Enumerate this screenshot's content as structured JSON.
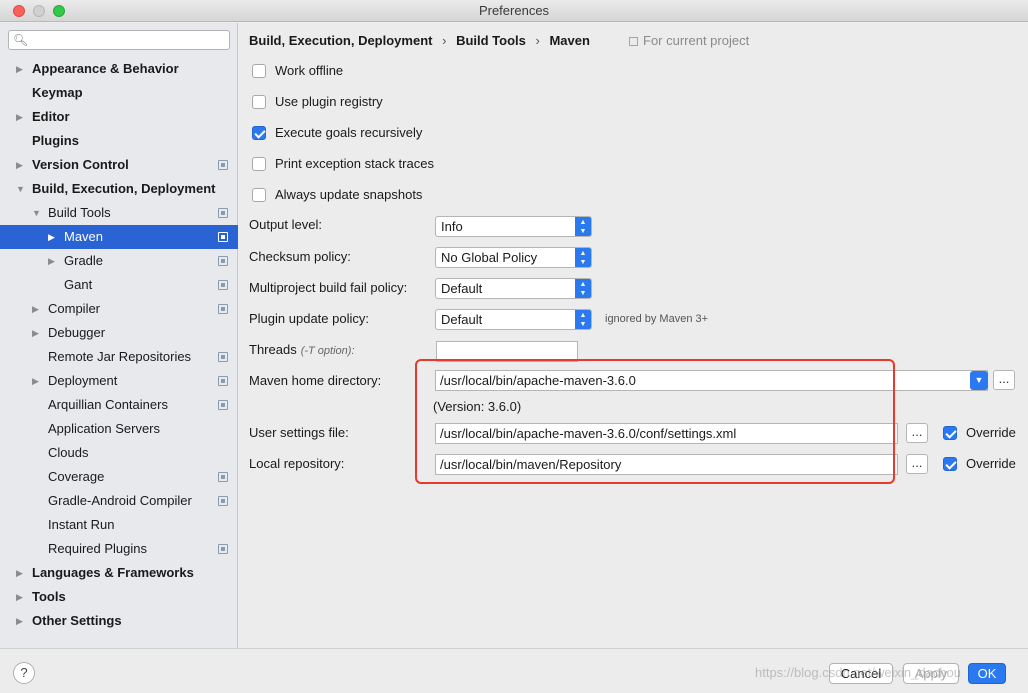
{
  "window": {
    "title": "Preferences"
  },
  "sidebar": {
    "search_value": "",
    "items": [
      {
        "label": "Appearance & Behavior",
        "bold": true,
        "arrow": "right",
        "level": 0,
        "project_icon": false
      },
      {
        "label": "Keymap",
        "bold": true,
        "arrow": "none",
        "level": 0,
        "project_icon": false
      },
      {
        "label": "Editor",
        "bold": true,
        "arrow": "right",
        "level": 0,
        "project_icon": false
      },
      {
        "label": "Plugins",
        "bold": true,
        "arrow": "none",
        "level": 0,
        "project_icon": false
      },
      {
        "label": "Version Control",
        "bold": true,
        "arrow": "right",
        "level": 0,
        "project_icon": true
      },
      {
        "label": "Build, Execution, Deployment",
        "bold": true,
        "arrow": "down",
        "level": 0,
        "project_icon": false
      },
      {
        "label": "Build Tools",
        "bold": false,
        "arrow": "down",
        "level": 1,
        "project_icon": true
      },
      {
        "label": "Maven",
        "bold": false,
        "arrow": "right",
        "level": 2,
        "project_icon": true,
        "selected": true
      },
      {
        "label": "Gradle",
        "bold": false,
        "arrow": "right",
        "level": 2,
        "project_icon": true
      },
      {
        "label": "Gant",
        "bold": false,
        "arrow": "none",
        "level": 2,
        "project_icon": true
      },
      {
        "label": "Compiler",
        "bold": false,
        "arrow": "right",
        "level": 1,
        "project_icon": true
      },
      {
        "label": "Debugger",
        "bold": false,
        "arrow": "right",
        "level": 1,
        "project_icon": false
      },
      {
        "label": "Remote Jar Repositories",
        "bold": false,
        "arrow": "none",
        "level": 1,
        "project_icon": true
      },
      {
        "label": "Deployment",
        "bold": false,
        "arrow": "right",
        "level": 1,
        "project_icon": true
      },
      {
        "label": "Arquillian Containers",
        "bold": false,
        "arrow": "none",
        "level": 1,
        "project_icon": true
      },
      {
        "label": "Application Servers",
        "bold": false,
        "arrow": "none",
        "level": 1,
        "project_icon": false
      },
      {
        "label": "Clouds",
        "bold": false,
        "arrow": "none",
        "level": 1,
        "project_icon": false
      },
      {
        "label": "Coverage",
        "bold": false,
        "arrow": "none",
        "level": 1,
        "project_icon": true
      },
      {
        "label": "Gradle-Android Compiler",
        "bold": false,
        "arrow": "none",
        "level": 1,
        "project_icon": true
      },
      {
        "label": "Instant Run",
        "bold": false,
        "arrow": "none",
        "level": 1,
        "project_icon": false
      },
      {
        "label": "Required Plugins",
        "bold": false,
        "arrow": "none",
        "level": 1,
        "project_icon": true
      },
      {
        "label": "Languages & Frameworks",
        "bold": true,
        "arrow": "right",
        "level": 0,
        "project_icon": false
      },
      {
        "label": "Tools",
        "bold": true,
        "arrow": "right",
        "level": 0,
        "project_icon": false
      },
      {
        "label": "Other Settings",
        "bold": true,
        "arrow": "right",
        "level": 0,
        "project_icon": false
      }
    ]
  },
  "breadcrumb": {
    "parts": [
      "Build, Execution, Deployment",
      "Build Tools",
      "Maven"
    ],
    "separator": "›",
    "for_project": "For current project"
  },
  "checkboxes": [
    {
      "label": "Work offline",
      "checked": false
    },
    {
      "label": "Use plugin registry",
      "checked": false
    },
    {
      "label": "Execute goals recursively",
      "checked": true
    },
    {
      "label": "Print exception stack traces",
      "checked": false
    },
    {
      "label": "Always update snapshots",
      "checked": false
    }
  ],
  "selects": [
    {
      "label": "Output level:",
      "value": "Info"
    },
    {
      "label": "Checksum policy:",
      "value": "No Global Policy"
    },
    {
      "label": "Multiproject build fail policy:",
      "value": "Default"
    },
    {
      "label": "Plugin update policy:",
      "value": "Default",
      "note": "ignored by Maven 3+"
    }
  ],
  "threads": {
    "label": "Threads",
    "hint": "(-T option):",
    "value": ""
  },
  "maven_home": {
    "label": "Maven home directory:",
    "value": "/usr/local/bin/apache-maven-3.6.0",
    "version": "(Version: 3.6.0)"
  },
  "user_settings": {
    "label": "User settings file:",
    "value": "/usr/local/bin/apache-maven-3.6.0/conf/settings.xml",
    "override_label": "Override",
    "override_checked": true
  },
  "local_repo": {
    "label": "Local repository:",
    "value": "/usr/local/bin/maven/Repository",
    "override_label": "Override",
    "override_checked": true
  },
  "browse_label": "...",
  "buttons": {
    "help": "?",
    "cancel": "Cancel",
    "apply": "Apply",
    "ok": "OK"
  },
  "watermark": "https://blog.csdn.net/weixin_dachou",
  "colors": {
    "selection": "#2a63d4",
    "accent": "#2a79f0",
    "highlight_box": "#e8392b"
  }
}
